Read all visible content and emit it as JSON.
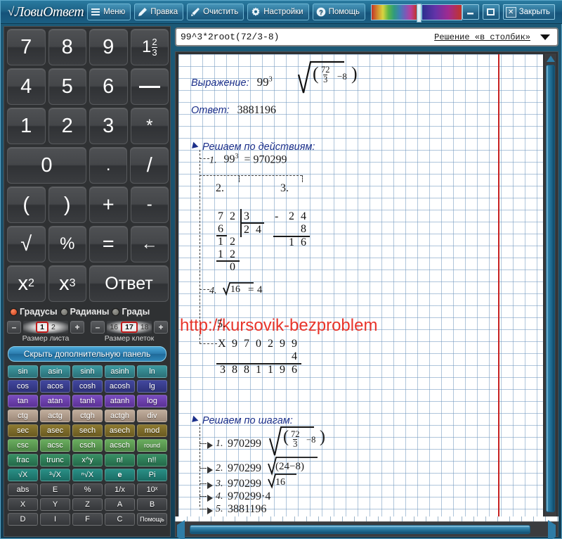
{
  "window": {
    "app_name": "ЛовиОтвет",
    "toolbar": [
      {
        "id": "menu",
        "label": "Меню",
        "icon": "menu-icon"
      },
      {
        "id": "edit",
        "label": "Правка",
        "icon": "pencil-icon"
      },
      {
        "id": "clear",
        "label": "Очистить",
        "icon": "eraser-icon"
      },
      {
        "id": "settings",
        "label": "Настройки",
        "icon": "gear-icon"
      },
      {
        "id": "help",
        "label": "Помощь",
        "icon": "question-icon"
      }
    ],
    "minimize_label": "–",
    "maximize_label": "□",
    "close_label": "Закрыть",
    "close_icon_glyph": "✕"
  },
  "formula_bar": {
    "expression": "99^3*2root(72/3-8)",
    "mode_label": "Решение «в столбик»",
    "dropdown_icon": "chevron-down-icon"
  },
  "keypad": {
    "rows": [
      [
        {
          "label": "7",
          "w": "w1"
        },
        {
          "label": "8",
          "w": "w1"
        },
        {
          "label": "9",
          "w": "w1"
        },
        {
          "label": "mixed-fraction",
          "w": "w1",
          "kind": "frac",
          "whole": "1",
          "num": "2",
          "den": "3"
        }
      ],
      [
        {
          "label": "4",
          "w": "w1"
        },
        {
          "label": "5",
          "w": "w1"
        },
        {
          "label": "6",
          "w": "w1"
        },
        {
          "label": "fraction-bar",
          "w": "w1",
          "kind": "dash"
        }
      ],
      [
        {
          "label": "1",
          "w": "w1"
        },
        {
          "label": "2",
          "w": "w1"
        },
        {
          "label": "3",
          "w": "w1"
        },
        {
          "label": "*",
          "w": "w1",
          "cls": "sm"
        }
      ],
      [
        {
          "label": "0",
          "w": "w2"
        },
        {
          "label": ".",
          "w": "w1",
          "cls": "sm"
        },
        {
          "label": "/",
          "w": "w1"
        }
      ],
      [
        {
          "label": "(",
          "w": "w1"
        },
        {
          "label": ")",
          "w": "w1"
        },
        {
          "label": "+",
          "w": "w1"
        },
        {
          "label": "-",
          "w": "w1",
          "cls": "sm"
        }
      ],
      [
        {
          "label": "√",
          "w": "w1"
        },
        {
          "label": "%",
          "w": "w1",
          "cls": "sm"
        },
        {
          "label": "=",
          "w": "w1"
        },
        {
          "label": "←",
          "w": "w1",
          "cls": "sm"
        }
      ],
      [
        {
          "label": "x",
          "w": "w1",
          "kind": "sup",
          "sup": "2"
        },
        {
          "label": "x",
          "w": "w1",
          "kind": "sup",
          "sup": "3"
        },
        {
          "label": "Ответ",
          "w": "w2",
          "cls": "answer"
        }
      ]
    ]
  },
  "angle_modes": {
    "options": [
      {
        "label": "Градусы",
        "selected": true
      },
      {
        "label": "Радианы",
        "selected": false
      },
      {
        "label": "Грады",
        "selected": false
      }
    ]
  },
  "steppers": [
    {
      "id": "sheet-size",
      "label": "Размер листа",
      "minus": "–",
      "plus": "+",
      "values": [
        "1",
        "2"
      ],
      "selected": "1"
    },
    {
      "id": "cell-size",
      "label": "Размер клеток",
      "minus": "–",
      "plus": "+",
      "values": [
        "16",
        "17",
        "18"
      ],
      "selected": "17"
    }
  ],
  "hide_panel_button": "Скрыть дополнительную панель",
  "function_grid": {
    "rows": [
      {
        "color": "#2f7f86",
        "labels": [
          "sin",
          "asin",
          "sinh",
          "asinh",
          "ln"
        ]
      },
      {
        "color": "#363a8a",
        "labels": [
          "cos",
          "acos",
          "cosh",
          "acosh",
          "lg"
        ]
      },
      {
        "color": "#6a3fae",
        "labels": [
          "tan",
          "atan",
          "tanh",
          "atanh",
          "log"
        ]
      },
      {
        "color": "#b3a08e",
        "labels": [
          "ctg",
          "actg",
          "ctgh",
          "actgh",
          "div"
        ]
      },
      {
        "color": "#7d6a2a",
        "labels": [
          "sec",
          "asec",
          "sech",
          "asech",
          "mod"
        ]
      },
      {
        "color": "#5a9a52",
        "labels": [
          "csc",
          "acsc",
          "csch",
          "acsch",
          "round"
        ]
      },
      {
        "color": "#2e7d4f",
        "labels": [
          "frac",
          "trunc",
          "x^y",
          "n!",
          "n!!"
        ]
      },
      {
        "color": "#1f7a72",
        "labels": [
          "√X",
          "³√X",
          "ⁿ√X",
          "e",
          "Pi"
        ]
      },
      {
        "color": "#3c3e41",
        "labels": [
          "abs",
          "E",
          "%",
          "1/x",
          "10ˣ"
        ]
      },
      {
        "color": "#3c3e41",
        "labels": [
          "X",
          "Y",
          "Z",
          "A",
          "B"
        ]
      },
      {
        "color": "#3c3e41",
        "labels": [
          "D",
          "I",
          "F",
          "C",
          "Помощь"
        ]
      }
    ]
  },
  "sheet": {
    "watermark": "http://kursovik-bezproblem",
    "expression_label": "Выражение:",
    "expression": {
      "base": "99",
      "exponent": "3",
      "radical_inner_numerator": "72",
      "radical_inner_denominator": "3",
      "radical_inner_subtrahend": "8"
    },
    "answer_label": "Ответ:",
    "answer_value": "3881196",
    "by_actions_heading": "Решаем по действиям:",
    "action1": {
      "index": "1.",
      "base": "99",
      "exp": "3",
      "equals": "=",
      "result": "970299"
    },
    "action2_marker": "2.",
    "action3_marker": "3.",
    "long_division": {
      "dividend": [
        "7",
        "2"
      ],
      "divisor": "3",
      "quotient": [
        "2",
        "4"
      ],
      "sub1": "6",
      "rem1": [
        "1",
        "2"
      ],
      "sub2": [
        "1",
        "2"
      ],
      "rem2": "0"
    },
    "subtraction": {
      "sign": "-",
      "minuend": [
        "2",
        "4"
      ],
      "subtrahend": "8",
      "result": [
        "1",
        "6"
      ]
    },
    "action4": {
      "index": "4.",
      "radicand": "16",
      "equals": "=",
      "result": "4"
    },
    "action5_marker": "5.",
    "multiplication": {
      "sign": "X",
      "factor1": [
        "9",
        "7",
        "0",
        "2",
        "9",
        "9"
      ],
      "factor2": "4",
      "product": [
        "3",
        "8",
        "8",
        "1",
        "1",
        "9",
        "6"
      ]
    },
    "by_steps_heading": "Решаем по шагам:",
    "steps": [
      {
        "index": "1.",
        "text": "970299",
        "kind": "frac_root",
        "num": "72",
        "den": "3",
        "sub": "8"
      },
      {
        "index": "2.",
        "text": "970299",
        "kind": "paren_root",
        "inner": "(24−8)"
      },
      {
        "index": "3.",
        "text": "970299",
        "kind": "simple_root",
        "inner": "16"
      },
      {
        "index": "4.",
        "text": "970299·4",
        "kind": "plain"
      },
      {
        "index": "5.",
        "text": "3881196",
        "kind": "plain"
      }
    ]
  },
  "scrollbars": {
    "v_up_icon": "triangle-up-icon",
    "h_left_icon": "triangle-left-icon",
    "h_right_icon": "triangle-right-icon"
  },
  "colors": {
    "titlebar": "#1c6287",
    "accent": "#2e7ca6",
    "sheet_grid": "#6e96be",
    "margin_line": "#c62020",
    "watermark": "#e8342a",
    "heading_blue": "#1b2f8a"
  }
}
